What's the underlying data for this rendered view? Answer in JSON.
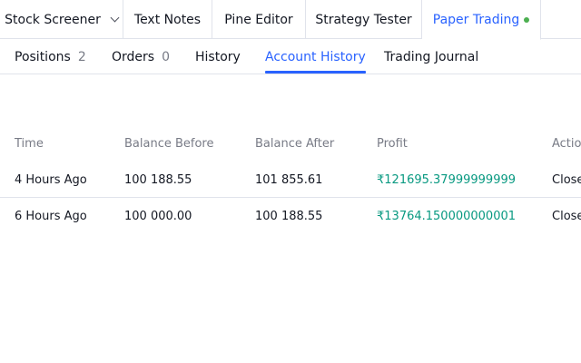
{
  "top_tabs": [
    {
      "label": "Stock Screener"
    },
    {
      "label": "Text Notes"
    },
    {
      "label": "Pine Editor"
    },
    {
      "label": "Strategy Tester"
    },
    {
      "label": "Paper Trading"
    }
  ],
  "sub_tabs": [
    {
      "label": "Positions",
      "count": "2"
    },
    {
      "label": "Orders",
      "count": "0"
    },
    {
      "label": "History"
    },
    {
      "label": "Account History"
    },
    {
      "label": "Trading Journal"
    }
  ],
  "table": {
    "headers": [
      "Time",
      "Balance Before",
      "Balance After",
      "Profit",
      "Actio"
    ],
    "rows": [
      [
        "4 Hours Ago",
        "100 188.55",
        "101 855.61",
        "₹121695.37999999999",
        "Close"
      ],
      [
        "6 Hours Ago",
        "100 000.00",
        "100 188.55",
        "₹13764.150000000001",
        "Close"
      ]
    ]
  },
  "colors": {
    "accent": "#2962ff",
    "profit": "#089981",
    "status_dot": "#4caf50"
  },
  "icons": {
    "dropdown": "chevron-down-icon",
    "status": "status-dot-icon"
  }
}
